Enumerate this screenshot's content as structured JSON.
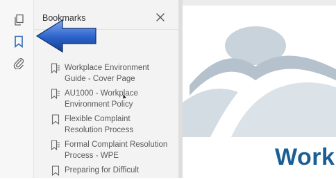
{
  "colors": {
    "rail_bg": "#f7f7f7",
    "panel_bg": "#f3f3f3",
    "active_icon": "#2d6bb5",
    "doc_accent": "#1b5e96",
    "arrow_fill": "#2a62c9"
  },
  "rail": {
    "icons": [
      {
        "name": "page-thumbnails-icon",
        "active": false
      },
      {
        "name": "bookmark-icon",
        "active": true
      },
      {
        "name": "attachment-icon",
        "active": false
      }
    ]
  },
  "panel": {
    "title": "Bookmarks",
    "close_icon": "close-icon"
  },
  "bookmarks": [
    {
      "icon": "tagged-bookmark-icon",
      "label": "Workplace Environment\nGuide - Cover Page"
    },
    {
      "icon": "tagged-bookmark-icon",
      "label": "AU1000 - Workplace\nEnvironment Policy"
    },
    {
      "icon": "bookmark-icon",
      "label": "Flexible Complaint\nResolution Process"
    },
    {
      "icon": "tagged-bookmark-icon",
      "label": "Formal Complaint Resolution\nProcess - WPE"
    },
    {
      "icon": "bookmark-icon",
      "label": "Preparing for Difficult"
    }
  ],
  "document": {
    "visible_word": "Work"
  }
}
